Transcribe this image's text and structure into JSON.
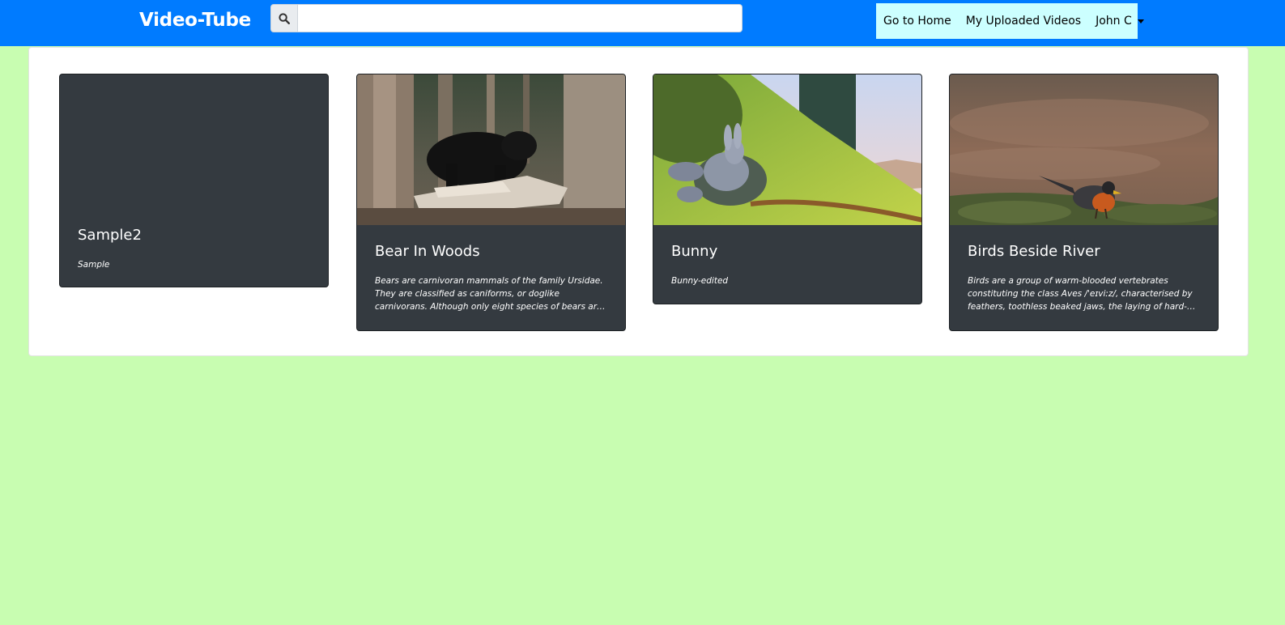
{
  "navbar": {
    "brand": "Video-Tube",
    "search": {
      "placeholder": "",
      "value": "",
      "icon": "search-icon"
    },
    "links": {
      "home": "Go to Home",
      "uploaded": "My Uploaded Videos",
      "user": "John C"
    }
  },
  "colors": {
    "navbar_bg": "#007bff",
    "page_bg": "#c8fdb1",
    "nav_right_bg": "#ccffff",
    "card_bg": "#343a40"
  },
  "videos": [
    {
      "title": "Sample2",
      "description": "Sample",
      "thumbnail": "none"
    },
    {
      "title": "Bear In Woods",
      "description": "Bears are carnivoran mammals of the family Ursidae. They are classified as caniforms, or doglike carnivorans. Although only eight species of bears are extant, they are widespread,...",
      "thumbnail": "bear-in-forest"
    },
    {
      "title": "Bunny",
      "description": "Bunny-edited",
      "thumbnail": "animated-bunny"
    },
    {
      "title": "Birds Beside River",
      "description": "Birds are a group of warm-blooded vertebrates constituting the class Aves /ˈeɪviːz/, characterised by feathers, toothless beaked jaws, the laying of hard-shelled eggs, a high...",
      "thumbnail": "robin-by-river"
    }
  ]
}
